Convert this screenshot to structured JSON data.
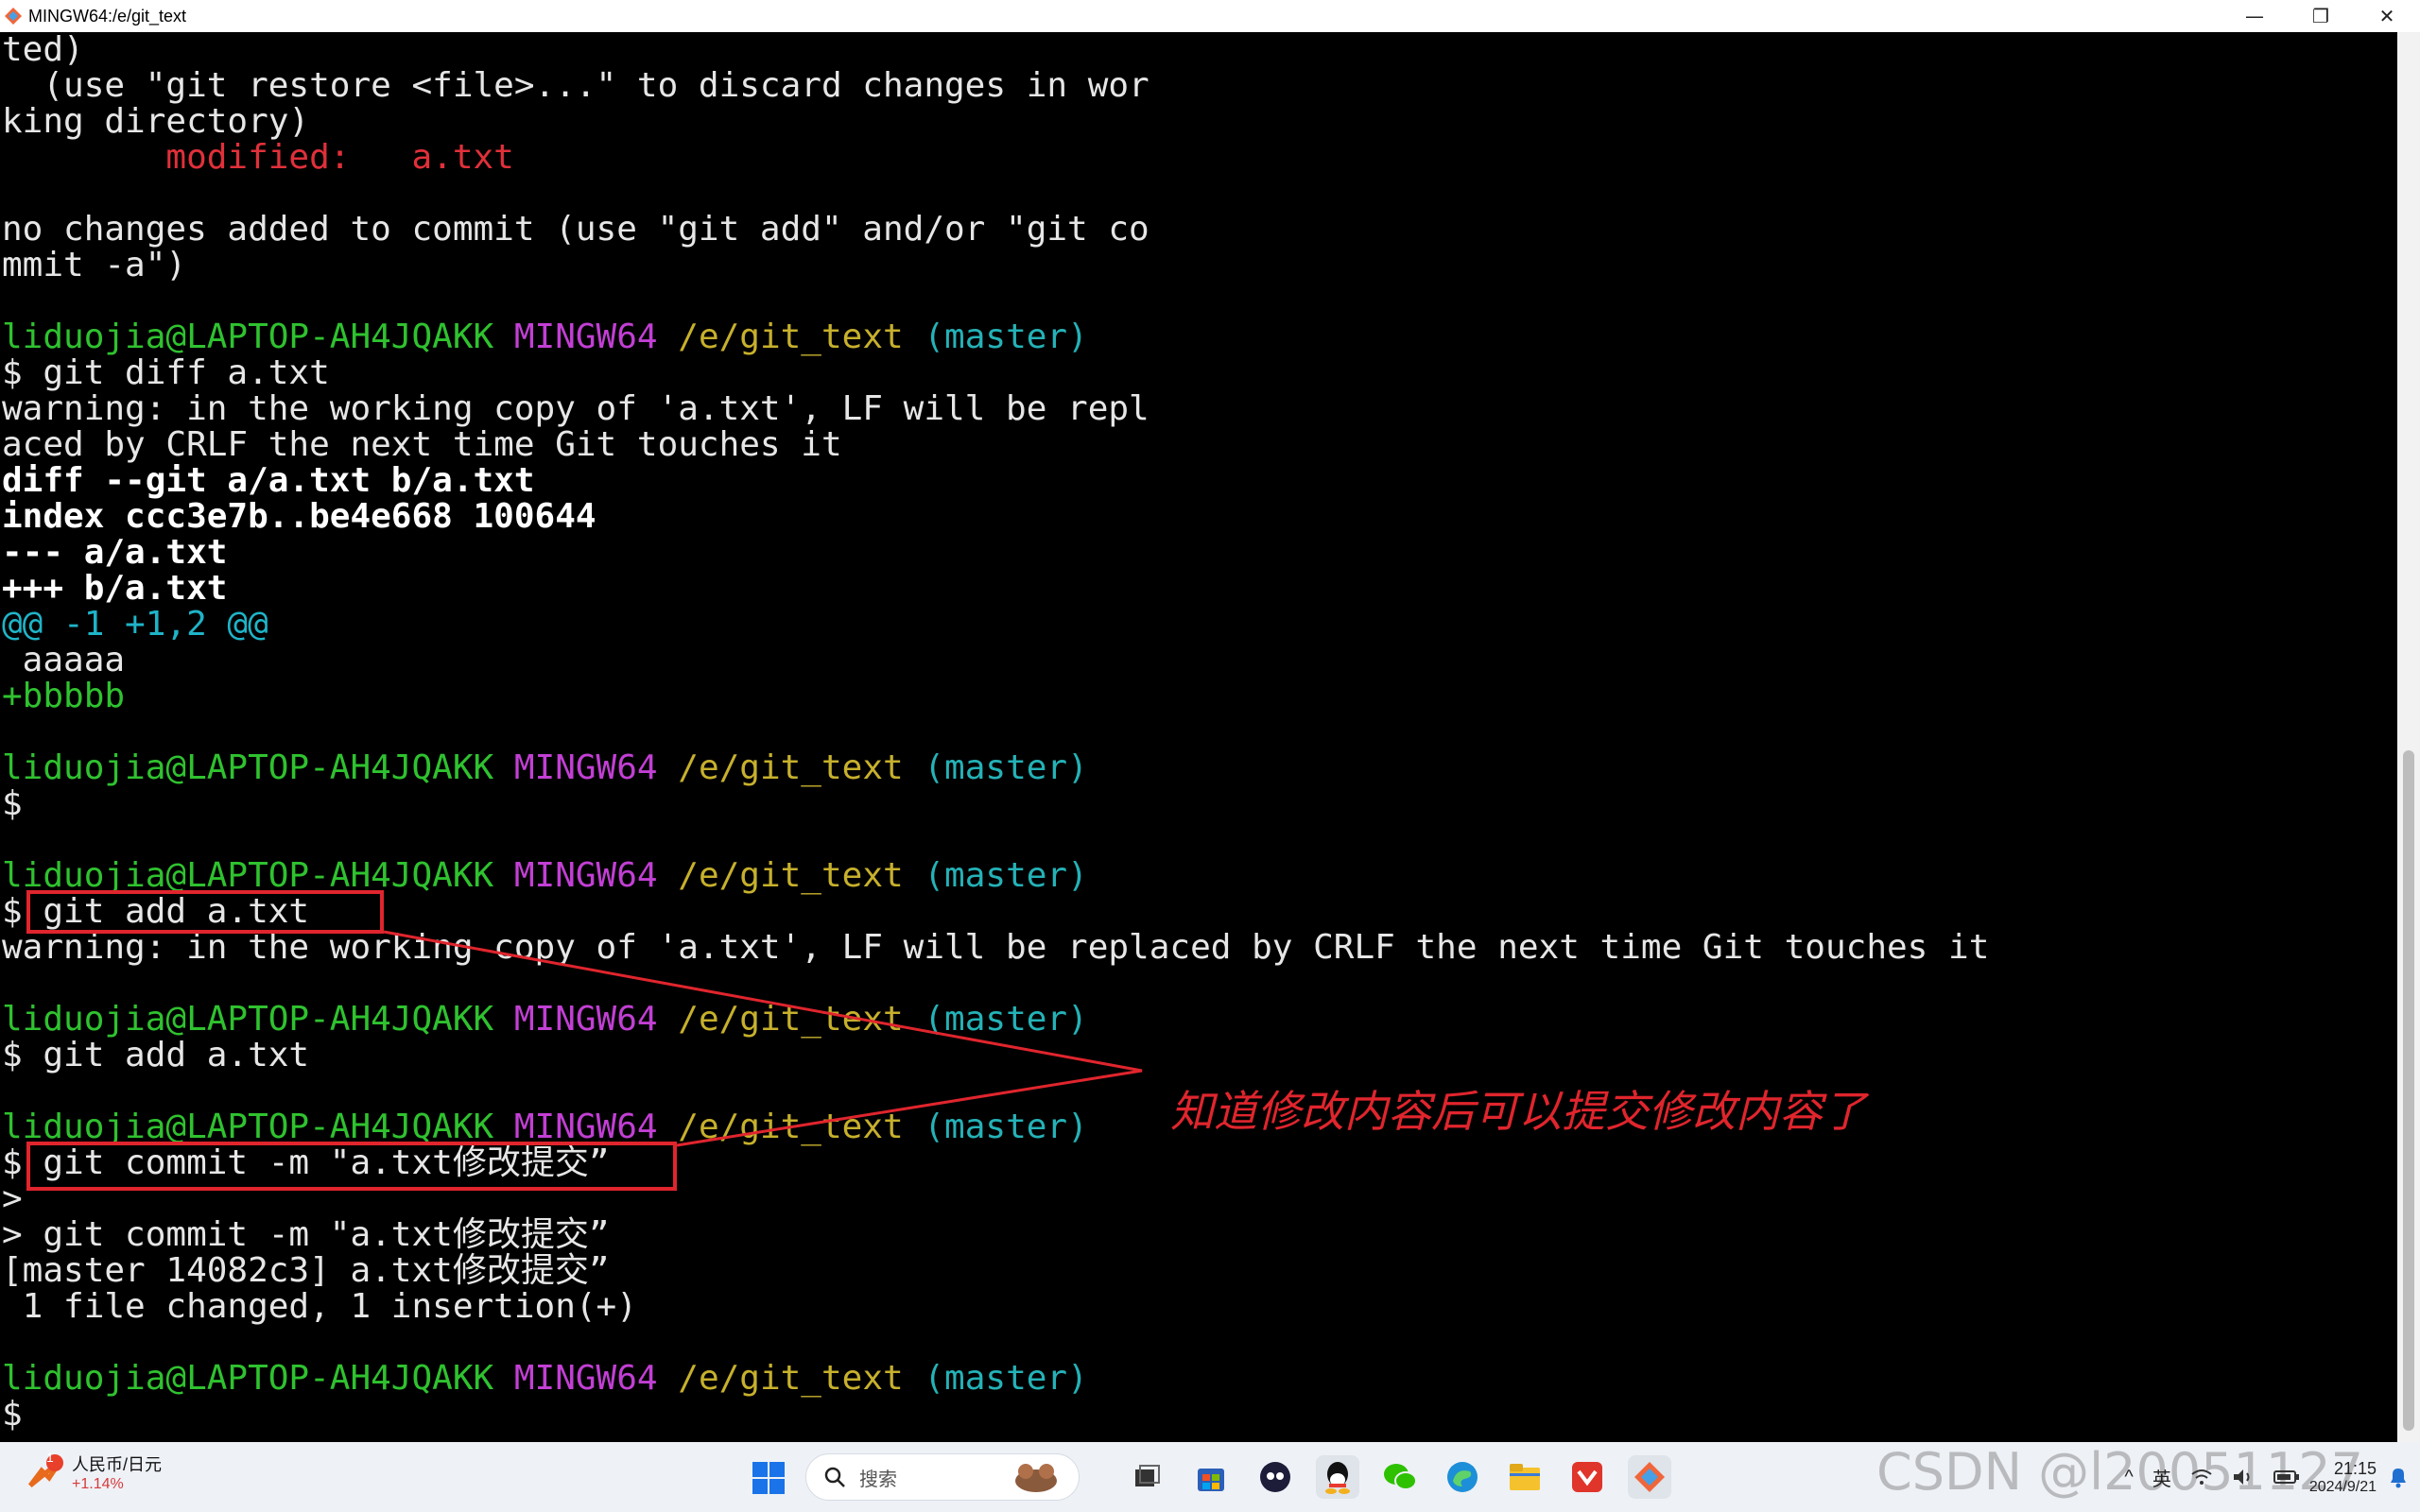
{
  "window": {
    "title": "MINGW64:/e/git_text",
    "controls": {
      "minimize": "—",
      "restore": "❐",
      "close": "✕"
    }
  },
  "prompt": {
    "user": "liduojia@LAPTOP-AH4JQAKK",
    "env": "MINGW64",
    "path": "/e/git_text",
    "branch": "(master)"
  },
  "terminal_lines": {
    "l0": "ted)",
    "l1": "  (use \"git restore <file>...\" to discard changes in wor",
    "l2": "king directory)",
    "l3_label": "        modified:   a.txt",
    "l5": "no changes added to commit (use \"git add\" and/or \"git co",
    "l6": "mmit -a\")",
    "l9": "$ git diff a.txt",
    "l10": "warning: in the working copy of 'a.txt', LF will be repl",
    "l11": "aced by CRLF the next time Git touches it",
    "l12": "diff --git a/a.txt b/a.txt",
    "l13": "index ccc3e7b..be4e668 100644",
    "l14": "--- a/a.txt",
    "l15": "+++ b/a.txt",
    "l16": "@@ -1 +1,2 @@",
    "l17": " aaaaa",
    "l18": "+bbbbb",
    "l21": "$",
    "l24": "$ git add a.txt",
    "l25": "warning: in the working copy of 'a.txt', LF will be replaced by CRLF the next time Git touches it",
    "l28": "$ git add a.txt",
    "l31": "$ git commit -m \"a.txt修改提交”",
    "l32": ">",
    "l33": "> git commit -m \"a.txt修改提交”",
    "l34": "[master 14082c3] a.txt修改提交”",
    "l35": " 1 file changed, 1 insertion(+)",
    "l38": "$"
  },
  "annotation": {
    "text": "知道修改内容后可以提交修改内容了",
    "color": "#e0252d"
  },
  "taskbar": {
    "widget_title": "人民币/日元",
    "widget_change": "+1.14%",
    "widget_badge": "1",
    "search_placeholder": "搜索",
    "apps": [
      "windows-start",
      "search",
      "bear-widget",
      "task-view",
      "microsoft-store",
      "bot-app",
      "qq",
      "wechat",
      "edge",
      "file-explorer",
      "wps",
      "git-gui"
    ],
    "tray": {
      "chevron": "^",
      "lang": "英",
      "wifi": "wifi",
      "volume": "volume",
      "battery": "battery"
    },
    "time": "21:15",
    "date": "2024/9/21",
    "watermark": "CSDN @l20051127"
  }
}
